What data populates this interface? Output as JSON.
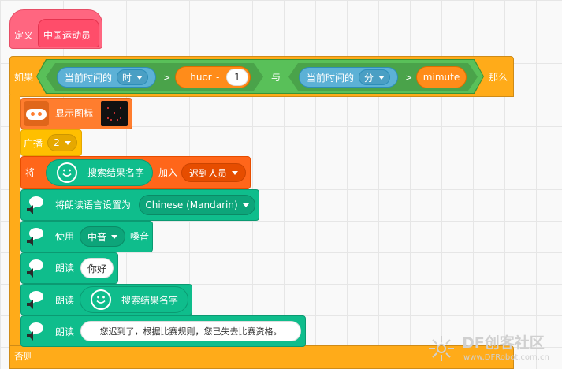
{
  "define_block": {
    "keyword": "定义",
    "name": "中国运动员"
  },
  "if_block": {
    "keyword": "如果",
    "then": "那么",
    "else": "否则",
    "cond1": {
      "left_label": "当前时间的",
      "unit": "时",
      "op": ">",
      "var": "huor",
      "minus": "-",
      "num": "1"
    },
    "and": "与",
    "cond2": {
      "left_label": "当前时间的",
      "unit": "分",
      "op": ">",
      "var": "mimute"
    }
  },
  "show_icon": {
    "label": "显示图标"
  },
  "broadcast": {
    "label": "广播",
    "value": "2"
  },
  "add_block": {
    "keyword": "将",
    "item": "搜索结果名字",
    "action": "加入",
    "list": "迟到人员"
  },
  "set_lang": {
    "label": "将朗读语言设置为",
    "value": "Chinese (Mandarin)"
  },
  "use_voice": {
    "label": "使用",
    "value": "中音",
    "suffix": "嗓音"
  },
  "say1": {
    "label": "朗读",
    "value": "你好"
  },
  "say2": {
    "label": "朗读",
    "value": "搜索结果名字"
  },
  "say3": {
    "label": "朗读",
    "value": "您迟到了，根据比赛规则，您已失去比赛资格。"
  },
  "watermark": {
    "title": "DF创客社区",
    "url": "www.DFRobot.com.cn"
  },
  "colors": {
    "define": "#ff6680",
    "control": "#ffab19",
    "operator": "#59c059",
    "sensing": "#5cb1d6",
    "variable": "#ff8c1a",
    "list": "#ff661a",
    "text2speech": "#0fbd8c",
    "extension": "#ff7d2e"
  }
}
